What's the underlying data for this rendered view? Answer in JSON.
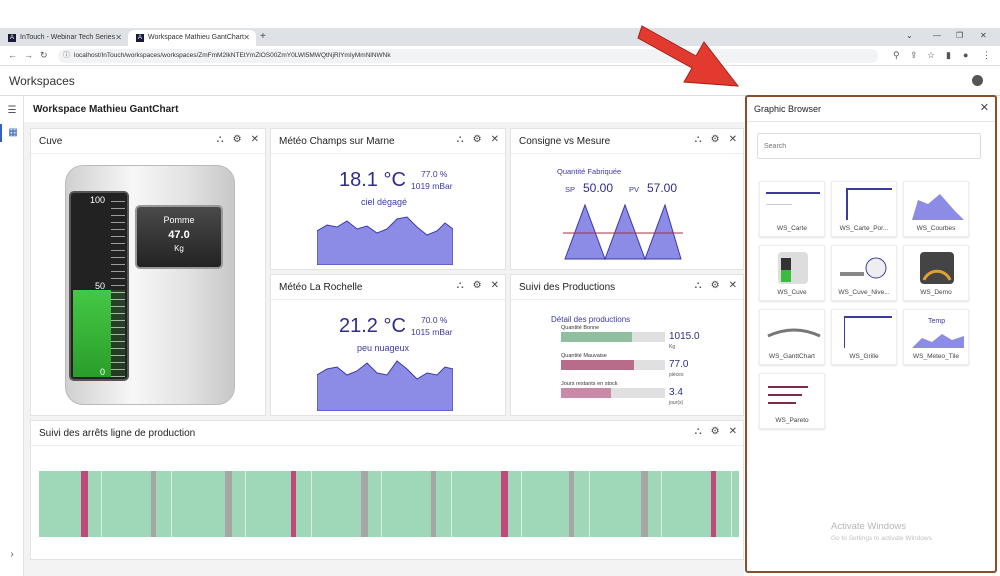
{
  "browser": {
    "tabs": [
      {
        "label": "InTouch - Webinar Tech Series"
      },
      {
        "label": "Workspace Mathieu GantChart"
      }
    ],
    "url": "localhost/InTouch/workspaces/workspaces/ZmFmM2lkNTEtYmZlOS00ZmY0LWI5MWQtNjRlYmIyMmNlNWNk"
  },
  "app": {
    "title": "Workspaces",
    "workspace_title": "Workspace Mathieu GantChart"
  },
  "cards": {
    "cuve": {
      "title": "Cuve",
      "scale": [
        "100",
        "50",
        "0"
      ],
      "product": "Pomme",
      "value": "47.0",
      "unit": "Kg",
      "level": 47
    },
    "meteo1": {
      "title": "Météo Champs sur Marne",
      "temp": "18.1 °C",
      "humidity": "77.0 %",
      "pressure": "1019 mBar",
      "desc": "ciel dégagé"
    },
    "consigne": {
      "title": "Consigne vs Mesure",
      "subtitle": "Quantité Fabriquée",
      "sp_label": "SP",
      "sp_value": "50.00",
      "pv_label": "PV",
      "pv_value": "57.00"
    },
    "meteo2": {
      "title": "Météo La Rochelle",
      "temp": "21.2 °C",
      "humidity": "70.0 %",
      "pressure": "1015 mBar",
      "desc": "peu nuageux"
    },
    "suivi": {
      "title": "Suivi des Productions",
      "subtitle": "Détail des productions",
      "rows": [
        {
          "label": "Quantité Bonne",
          "value": "1015.0",
          "unit": "Kg",
          "color": "#8fbf9f",
          "fill": 0.68
        },
        {
          "label": "Quantité Mauvaise",
          "value": "77.0",
          "unit": "pièces",
          "color": "#b86c8a",
          "fill": 0.7
        },
        {
          "label": "Jours restants en stock",
          "value": "3.4",
          "unit": "jour(s)",
          "color": "#c98aa8",
          "fill": 0.48
        }
      ]
    },
    "arrets": {
      "title": "Suivi des arrêts ligne de production"
    }
  },
  "graphic_browser": {
    "title": "Graphic Browser",
    "search_placeholder": "Search",
    "items": [
      {
        "label": "WS_Carte"
      },
      {
        "label": "WS_Carte_Por..."
      },
      {
        "label": "WS_Courbes"
      },
      {
        "label": "WS_Cuve"
      },
      {
        "label": "WS_Cuve_Nive..."
      },
      {
        "label": "WS_Demo"
      },
      {
        "label": "WS_GanttChart"
      },
      {
        "label": "WS_Grille"
      },
      {
        "label": "WS_Meteo_Tile",
        "thumb_text": "Temp"
      },
      {
        "label": "WS_Pareto"
      }
    ],
    "watermark_title": "Activate Windows",
    "watermark_sub": "Go to Settings to activate Windows."
  },
  "colors": {
    "accent_blue": "#2d2d8e",
    "chart_fill": "#8c8ce6",
    "gauge_green": "#3cbc3c",
    "gantt_green": "#9ed8b8",
    "browser_border": "#8b4e2c",
    "arrow_red": "#e23a2e"
  }
}
